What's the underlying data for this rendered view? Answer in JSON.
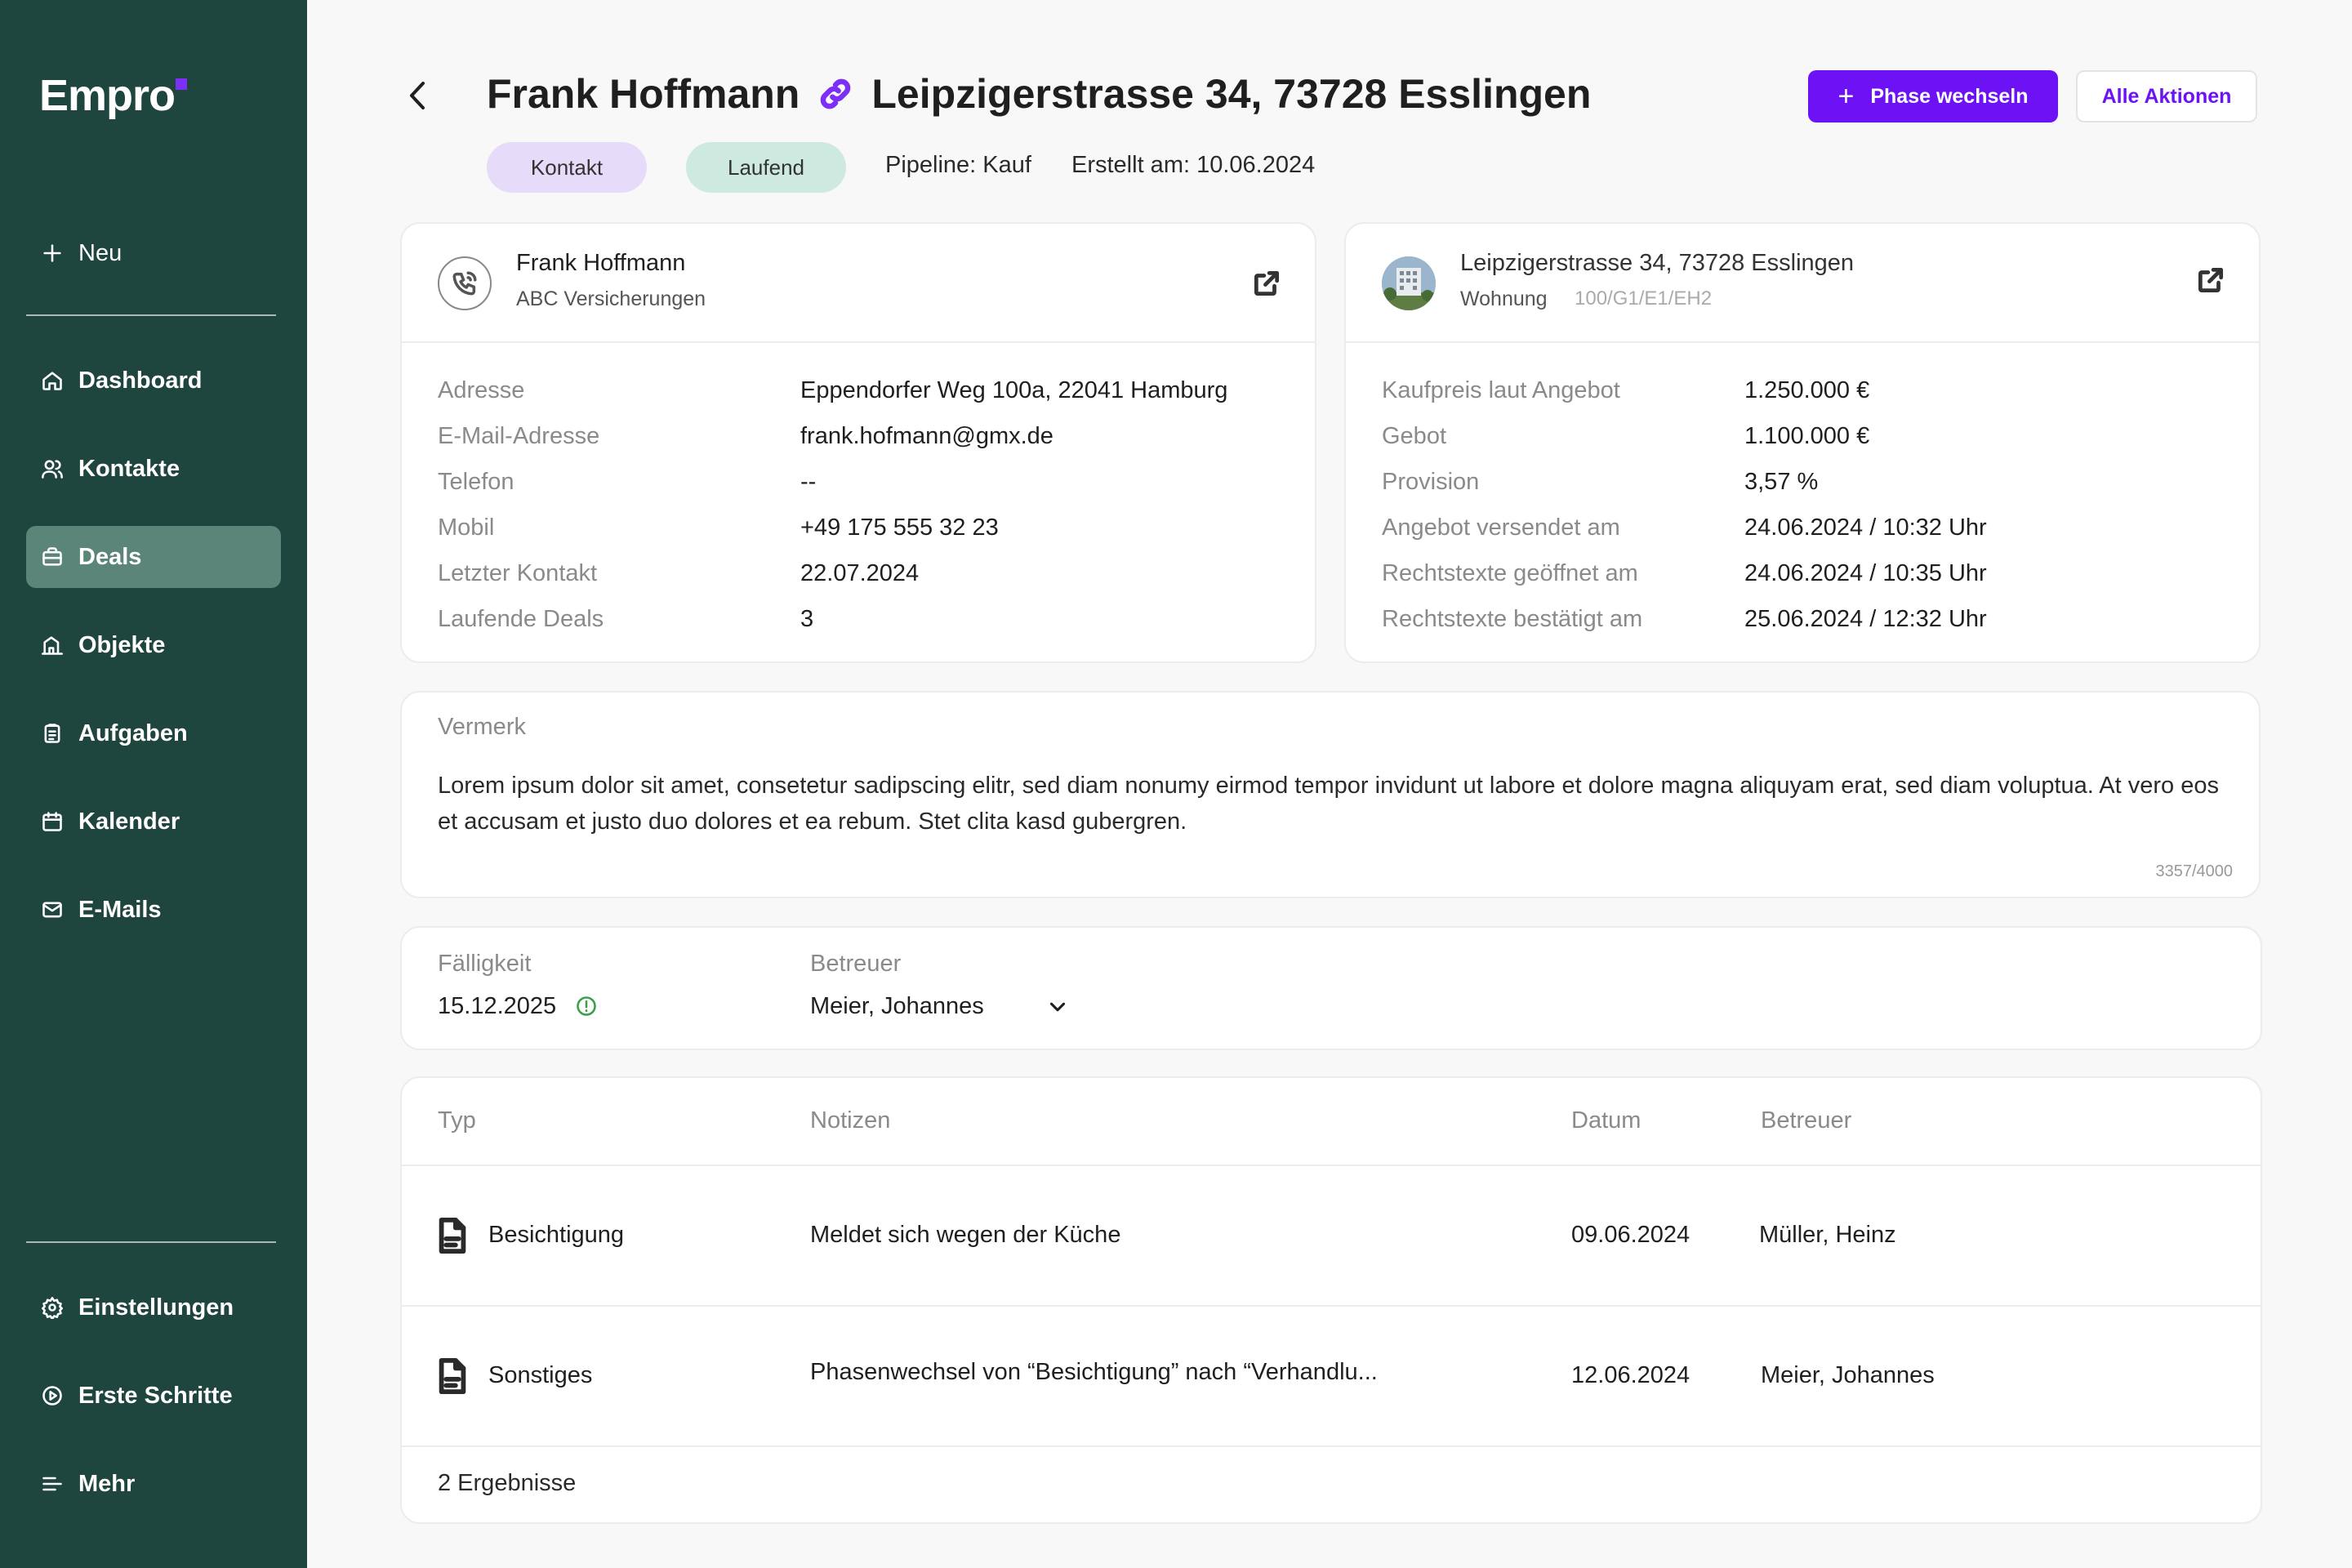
{
  "app": {
    "logo": "Empro"
  },
  "sidebar": {
    "new_label": "Neu",
    "items": [
      {
        "label": "Dashboard",
        "icon": "home-icon"
      },
      {
        "label": "Kontakte",
        "icon": "users-icon"
      },
      {
        "label": "Deals",
        "icon": "briefcase-icon",
        "active": true
      },
      {
        "label": "Objekte",
        "icon": "building-icon"
      },
      {
        "label": "Aufgaben",
        "icon": "clipboard-icon"
      },
      {
        "label": "Kalender",
        "icon": "calendar-icon"
      },
      {
        "label": "E-Mails",
        "icon": "mail-icon"
      }
    ],
    "bottom": [
      {
        "label": "Einstellungen",
        "icon": "gear-icon"
      },
      {
        "label": "Erste Schritte",
        "icon": "play-icon"
      },
      {
        "label": "Mehr",
        "icon": "menu-icon"
      }
    ]
  },
  "header": {
    "contact_name": "Frank Hoffmann",
    "address": "Leipzigerstrasse 34, 73728 Esslingen",
    "phase_button": "Phase wechseln",
    "actions_button": "Alle Aktionen",
    "tag_type": "Kontakt",
    "tag_status": "Laufend",
    "pipeline": "Pipeline: Kauf",
    "created": "Erstellt am: 10.06.2024"
  },
  "contact_card": {
    "name": "Frank Hoffmann",
    "company": "ABC Versicherungen",
    "rows": [
      {
        "label": "Adresse",
        "value": "Eppendorfer Weg 100a, 22041 Hamburg"
      },
      {
        "label": "E-Mail-Adresse",
        "value": "frank.hofmann@gmx.de"
      },
      {
        "label": "Telefon",
        "value": "--"
      },
      {
        "label": "Mobil",
        "value": "+49 175 555 32 23"
      },
      {
        "label": "Letzter Kontakt",
        "value": "22.07.2024"
      },
      {
        "label": "Laufende Deals",
        "value": "3"
      }
    ]
  },
  "property_card": {
    "address": "Leipzigerstrasse 34, 73728 Esslingen",
    "type": "Wohnung",
    "code": "100/G1/E1/EH2",
    "rows": [
      {
        "label": "Kaufpreis laut Angebot",
        "value": "1.250.000 €"
      },
      {
        "label": "Gebot",
        "value": "1.100.000 €"
      },
      {
        "label": "Provision",
        "value": "3,57 %"
      },
      {
        "label": "Angebot versendet am",
        "value": "24.06.2024 / 10:32 Uhr"
      },
      {
        "label": "Rechtstexte geöffnet am",
        "value": "24.06.2024 / 10:35 Uhr"
      },
      {
        "label": "Rechtstexte bestätigt am",
        "value": "25.06.2024 / 12:32 Uhr"
      }
    ]
  },
  "note": {
    "label": "Vermerk",
    "text": "Lorem ipsum dolor sit amet, consetetur sadipscing elitr, sed diam nonumy eirmod tempor invidunt ut labore et dolore magna aliquyam erat, sed diam voluptua. At vero eos et accusam et justo duo dolores et ea rebum. Stet clita kasd gubergren.",
    "counter": "3357/4000"
  },
  "due": {
    "due_label": "Fälligkeit",
    "due_value": "15.12.2025",
    "owner_label": "Betreuer",
    "owner_value": "Meier, Johannes"
  },
  "activities": {
    "headers": {
      "type": "Typ",
      "notes": "Notizen",
      "date": "Datum",
      "owner": "Betreuer"
    },
    "rows": [
      {
        "type": "Besichtigung",
        "notes": "Meldet sich wegen der Küche",
        "date": "09.06.2024",
        "owner": "Müller, Heinz"
      },
      {
        "type": "Sonstiges",
        "notes": "Phasenwechsel von “Besichtigung” nach “Verhandlu...",
        "date": "12.06.2024",
        "owner": "Meier, Johannes"
      }
    ],
    "footer": "2 Ergebnisse"
  },
  "colors": {
    "sidebar": "#1e463e",
    "accent": "#6d12f5",
    "active_nav": "#5a8578"
  }
}
